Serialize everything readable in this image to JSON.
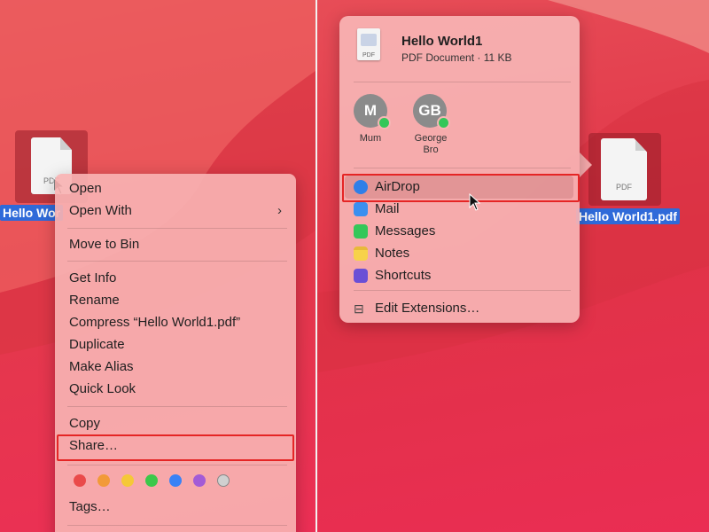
{
  "left": {
    "file": {
      "label": "Hello Wor",
      "type_text": "PDF"
    },
    "context_menu": {
      "items": [
        {
          "label": "Open"
        },
        {
          "label": "Open With",
          "has_submenu": true
        },
        {
          "label": "Move to Bin"
        },
        {
          "label": "Get Info"
        },
        {
          "label": "Rename"
        },
        {
          "label": "Compress “Hello World1.pdf”"
        },
        {
          "label": "Duplicate"
        },
        {
          "label": "Make Alias"
        },
        {
          "label": "Quick Look"
        },
        {
          "label": "Copy"
        },
        {
          "label": "Share…",
          "highlighted": true
        },
        {
          "label": "Tags…"
        }
      ],
      "tag_colors": [
        "#ea4a4a",
        "#f29a38",
        "#f5c838",
        "#3cc84a",
        "#3a82f6",
        "#a35bd6",
        "#d0d0d0"
      ]
    }
  },
  "right": {
    "file": {
      "label": "Hello World1.pdf",
      "type_text": "PDF"
    },
    "share_menu": {
      "header": {
        "title": "Hello World1",
        "subtitle": "PDF Document · 11 KB",
        "icon_text": "PDF"
      },
      "contacts": [
        {
          "initials": "M",
          "name": "Mum"
        },
        {
          "initials": "GB",
          "name": "George\nBro"
        }
      ],
      "items": [
        {
          "label": "AirDrop",
          "icon": "airdrop-icon",
          "color": "#2f7fe8",
          "highlighted": true
        },
        {
          "label": "Mail",
          "icon": "mail-icon",
          "color": "#3a8ff0"
        },
        {
          "label": "Messages",
          "icon": "messages-icon",
          "color": "#34c759"
        },
        {
          "label": "Notes",
          "icon": "notes-icon",
          "color": "#f7d24a"
        },
        {
          "label": "Shortcuts",
          "icon": "shortcuts-icon",
          "color": "#6a4fd6"
        }
      ],
      "footer": {
        "label": "Edit Extensions…"
      }
    }
  }
}
